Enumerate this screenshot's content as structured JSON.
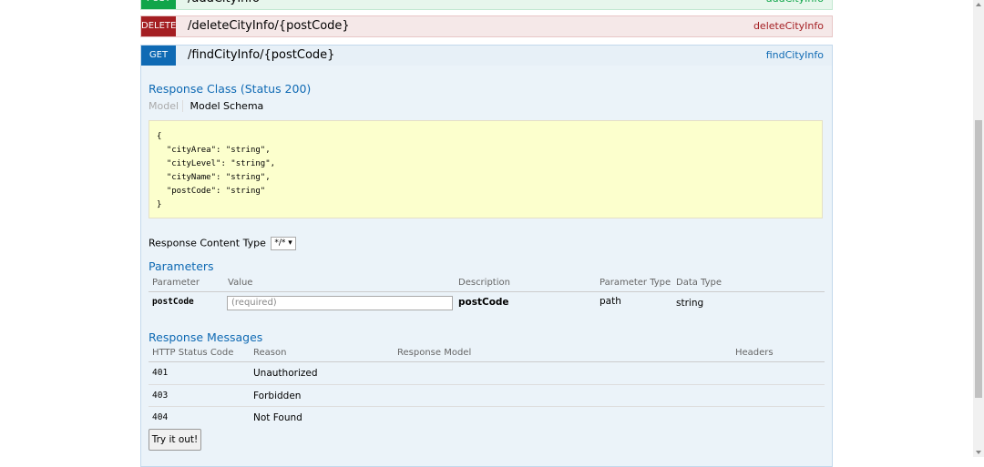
{
  "operations": {
    "post": {
      "method": "POST",
      "path": "/addCityInfo",
      "nickname": "addCityInfo"
    },
    "delete": {
      "method": "DELETE",
      "path": "/deleteCityInfo/{postCode}",
      "nickname": "deleteCityInfo"
    },
    "get": {
      "method": "GET",
      "path": "/findCityInfo/{postCode}",
      "nickname": "findCityInfo"
    }
  },
  "response_class": {
    "title": "Response Class (Status 200)",
    "tab_model": "Model",
    "tab_schema": "Model Schema",
    "code_lines": [
      "{",
      "  \"cityArea\": \"string\",",
      "  \"cityLevel\": \"string\",",
      "  \"cityName\": \"string\",",
      "  \"postCode\": \"string\"",
      "}"
    ]
  },
  "content_type": {
    "label": "Response Content Type",
    "value": "*/*"
  },
  "parameters": {
    "title": "Parameters",
    "headers": [
      "Parameter",
      "Value",
      "Description",
      "Parameter Type",
      "Data Type"
    ],
    "rows": [
      {
        "name": "postCode",
        "placeholder": "(required)",
        "description": "postCode",
        "param_type": "path",
        "data_type": "string"
      }
    ]
  },
  "response_messages": {
    "title": "Response Messages",
    "headers": [
      "HTTP Status Code",
      "Reason",
      "Response Model",
      "Headers"
    ],
    "rows": [
      {
        "code": "401",
        "reason": "Unauthorized"
      },
      {
        "code": "403",
        "reason": "Forbidden"
      },
      {
        "code": "404",
        "reason": "Not Found"
      }
    ]
  },
  "try_button": "Try it out!"
}
